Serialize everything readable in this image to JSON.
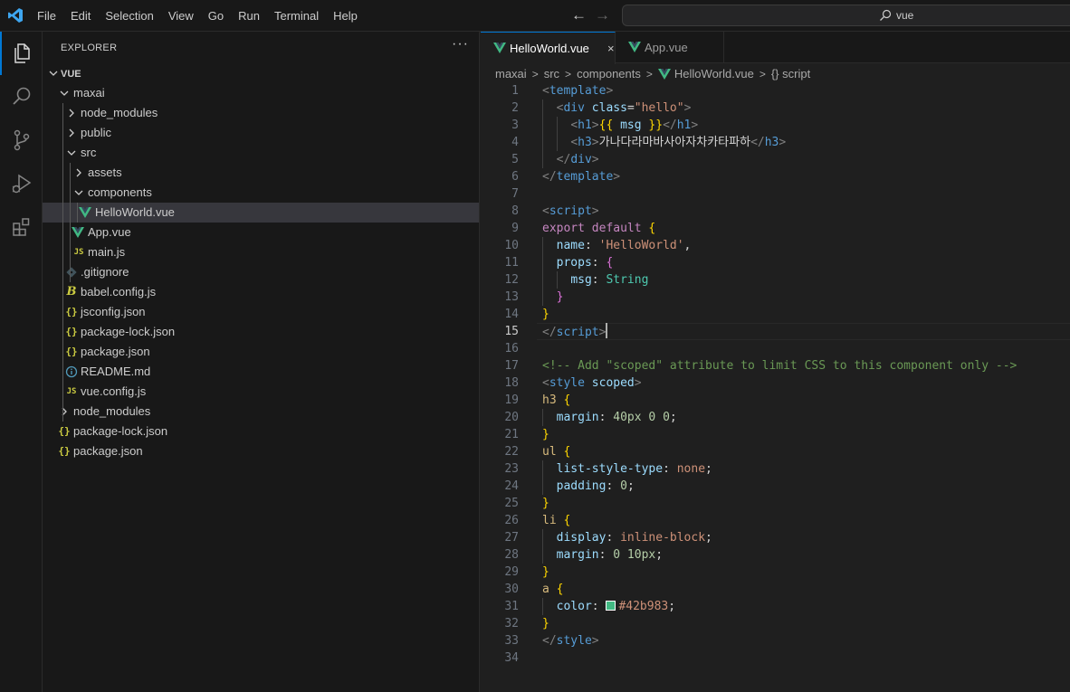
{
  "menu": [
    "File",
    "Edit",
    "Selection",
    "View",
    "Go",
    "Run",
    "Terminal",
    "Help"
  ],
  "nav": {
    "back": "←",
    "forward": "→"
  },
  "command_center": {
    "label": "vue"
  },
  "activity_bar": [
    "explorer-icon",
    "search-icon",
    "source-control-icon",
    "run-debug-icon",
    "extensions-icon"
  ],
  "explorer": {
    "title": "EXPLORER",
    "more": "···",
    "tree": [
      {
        "label": "VUE",
        "depth": 0,
        "type": "root",
        "icon": "chevron-down-icon"
      },
      {
        "label": "maxai",
        "depth": 1,
        "type": "folder-open",
        "icon": "chevron-down-icon"
      },
      {
        "label": "node_modules",
        "depth": 2,
        "type": "folder",
        "icon": "chevron-right-icon"
      },
      {
        "label": "public",
        "depth": 2,
        "type": "folder",
        "icon": "chevron-right-icon"
      },
      {
        "label": "src",
        "depth": 2,
        "type": "folder-open",
        "icon": "chevron-down-icon"
      },
      {
        "label": "assets",
        "depth": 3,
        "type": "folder",
        "icon": "chevron-right-icon"
      },
      {
        "label": "components",
        "depth": 3,
        "type": "folder-open",
        "icon": "chevron-down-icon"
      },
      {
        "label": "HelloWorld.vue",
        "depth": 4,
        "type": "vue",
        "icon": "vue-icon",
        "selected": true
      },
      {
        "label": "App.vue",
        "depth": 3,
        "type": "vue",
        "icon": "vue-icon"
      },
      {
        "label": "main.js",
        "depth": 3,
        "type": "js",
        "icon": "js-icon"
      },
      {
        "label": ".gitignore",
        "depth": 2,
        "type": "git",
        "icon": "git-icon"
      },
      {
        "label": "babel.config.js",
        "depth": 2,
        "type": "babel",
        "icon": "babel-icon"
      },
      {
        "label": "jsconfig.json",
        "depth": 2,
        "type": "json",
        "icon": "json-icon"
      },
      {
        "label": "package-lock.json",
        "depth": 2,
        "type": "json",
        "icon": "json-icon"
      },
      {
        "label": "package.json",
        "depth": 2,
        "type": "json",
        "icon": "json-icon"
      },
      {
        "label": "README.md",
        "depth": 2,
        "type": "info",
        "icon": "info-icon"
      },
      {
        "label": "vue.config.js",
        "depth": 2,
        "type": "js",
        "icon": "js-icon"
      },
      {
        "label": "node_modules",
        "depth": 1,
        "type": "folder",
        "icon": "chevron-right-icon"
      },
      {
        "label": "package-lock.json",
        "depth": 1,
        "type": "json",
        "icon": "json-icon"
      },
      {
        "label": "package.json",
        "depth": 1,
        "type": "json",
        "icon": "json-icon"
      }
    ]
  },
  "tabs": [
    {
      "label": "HelloWorld.vue",
      "active": true,
      "close": "×"
    },
    {
      "label": "App.vue",
      "active": false
    }
  ],
  "breadcrumb": [
    "maxai",
    "src",
    "components",
    "HelloWorld.vue",
    "{} script"
  ],
  "colors": {
    "accent": "#0078d4",
    "vue": "#41b883",
    "js": "#cbcb41",
    "swatch": "#42b983"
  },
  "cursor_line": 15,
  "code": [
    {
      "n": 1,
      "indent": 0,
      "tokens": [
        [
          "brk",
          "<"
        ],
        [
          "tag",
          "template"
        ],
        [
          "brk",
          ">"
        ]
      ]
    },
    {
      "n": 2,
      "indent": 1,
      "tokens": [
        [
          "brk",
          "<"
        ],
        [
          "tag",
          "div "
        ],
        [
          "attr",
          "class"
        ],
        [
          "txt",
          "="
        ],
        [
          "str",
          "\"hello\""
        ],
        [
          "brk",
          ">"
        ]
      ]
    },
    {
      "n": 3,
      "indent": 2,
      "tokens": [
        [
          "brk",
          "<"
        ],
        [
          "tag",
          "h1"
        ],
        [
          "brk",
          ">"
        ],
        [
          "yb",
          "{{"
        ],
        [
          "txt",
          " "
        ],
        [
          "attr",
          "msg"
        ],
        [
          "txt",
          " "
        ],
        [
          "yb",
          "}}"
        ],
        [
          "brk",
          "</"
        ],
        [
          "tag",
          "h1"
        ],
        [
          "brk",
          ">"
        ]
      ]
    },
    {
      "n": 4,
      "indent": 2,
      "tokens": [
        [
          "brk",
          "<"
        ],
        [
          "tag",
          "h3"
        ],
        [
          "brk",
          ">"
        ],
        [
          "txt",
          "가나다라마바사아자차카타파하"
        ],
        [
          "brk",
          "</"
        ],
        [
          "tag",
          "h3"
        ],
        [
          "brk",
          ">"
        ]
      ]
    },
    {
      "n": 5,
      "indent": 1,
      "tokens": [
        [
          "brk",
          "</"
        ],
        [
          "tag",
          "div"
        ],
        [
          "brk",
          ">"
        ]
      ]
    },
    {
      "n": 6,
      "indent": 0,
      "tokens": [
        [
          "brk",
          "</"
        ],
        [
          "tag",
          "template"
        ],
        [
          "brk",
          ">"
        ]
      ]
    },
    {
      "n": 7,
      "indent": 0,
      "tokens": []
    },
    {
      "n": 8,
      "indent": 0,
      "tokens": [
        [
          "brk",
          "<"
        ],
        [
          "tag",
          "script"
        ],
        [
          "brk",
          ">"
        ]
      ]
    },
    {
      "n": 9,
      "indent": 0,
      "tokens": [
        [
          "kw",
          "export default "
        ],
        [
          "yb",
          "{"
        ]
      ]
    },
    {
      "n": 10,
      "indent": 1,
      "tokens": [
        [
          "attr",
          "name"
        ],
        [
          "txt",
          ": "
        ],
        [
          "str",
          "'HelloWorld'"
        ],
        [
          "txt",
          ","
        ]
      ]
    },
    {
      "n": 11,
      "indent": 1,
      "tokens": [
        [
          "attr",
          "props"
        ],
        [
          "txt",
          ": "
        ],
        [
          "pb",
          "{"
        ]
      ]
    },
    {
      "n": 12,
      "indent": 2,
      "tokens": [
        [
          "attr",
          "msg"
        ],
        [
          "txt",
          ": "
        ],
        [
          "type",
          "String"
        ]
      ]
    },
    {
      "n": 13,
      "indent": 1,
      "tokens": [
        [
          "pb",
          "}"
        ]
      ]
    },
    {
      "n": 14,
      "indent": 0,
      "tokens": [
        [
          "yb",
          "}"
        ]
      ]
    },
    {
      "n": 15,
      "indent": 0,
      "tokens": [
        [
          "brk",
          "</"
        ],
        [
          "tag",
          "script"
        ],
        [
          "brk",
          ">"
        ]
      ]
    },
    {
      "n": 16,
      "indent": 0,
      "tokens": []
    },
    {
      "n": 17,
      "indent": 0,
      "tokens": [
        [
          "cmt",
          "<!-- Add \"scoped\" attribute to limit CSS to this component only -->"
        ]
      ]
    },
    {
      "n": 18,
      "indent": 0,
      "tokens": [
        [
          "brk",
          "<"
        ],
        [
          "tag",
          "style "
        ],
        [
          "attr",
          "scoped"
        ],
        [
          "brk",
          ">"
        ]
      ]
    },
    {
      "n": 19,
      "indent": 0,
      "tokens": [
        [
          "sel",
          "h3 "
        ],
        [
          "yb",
          "{"
        ]
      ]
    },
    {
      "n": 20,
      "indent": 1,
      "tokens": [
        [
          "attr",
          "margin"
        ],
        [
          "txt",
          ": "
        ],
        [
          "num",
          "40px 0 0"
        ],
        [
          "txt",
          ";"
        ]
      ]
    },
    {
      "n": 21,
      "indent": 0,
      "tokens": [
        [
          "yb",
          "}"
        ]
      ]
    },
    {
      "n": 22,
      "indent": 0,
      "tokens": [
        [
          "sel",
          "ul "
        ],
        [
          "yb",
          "{"
        ]
      ]
    },
    {
      "n": 23,
      "indent": 1,
      "tokens": [
        [
          "attr",
          "list-style-type"
        ],
        [
          "txt",
          ": "
        ],
        [
          "val",
          "none"
        ],
        [
          "txt",
          ";"
        ]
      ]
    },
    {
      "n": 24,
      "indent": 1,
      "tokens": [
        [
          "attr",
          "padding"
        ],
        [
          "txt",
          ": "
        ],
        [
          "num",
          "0"
        ],
        [
          "txt",
          ";"
        ]
      ]
    },
    {
      "n": 25,
      "indent": 0,
      "tokens": [
        [
          "yb",
          "}"
        ]
      ]
    },
    {
      "n": 26,
      "indent": 0,
      "tokens": [
        [
          "sel",
          "li "
        ],
        [
          "yb",
          "{"
        ]
      ]
    },
    {
      "n": 27,
      "indent": 1,
      "tokens": [
        [
          "attr",
          "display"
        ],
        [
          "txt",
          ": "
        ],
        [
          "val",
          "inline-block"
        ],
        [
          "txt",
          ";"
        ]
      ]
    },
    {
      "n": 28,
      "indent": 1,
      "tokens": [
        [
          "attr",
          "margin"
        ],
        [
          "txt",
          ": "
        ],
        [
          "num",
          "0 10px"
        ],
        [
          "txt",
          ";"
        ]
      ]
    },
    {
      "n": 29,
      "indent": 0,
      "tokens": [
        [
          "yb",
          "}"
        ]
      ]
    },
    {
      "n": 30,
      "indent": 0,
      "tokens": [
        [
          "sel",
          "a "
        ],
        [
          "yb",
          "{"
        ]
      ]
    },
    {
      "n": 31,
      "indent": 1,
      "tokens": [
        [
          "attr",
          "color"
        ],
        [
          "txt",
          ": "
        ],
        [
          "swatch",
          ""
        ],
        [
          "val",
          "#42b983"
        ],
        [
          "txt",
          ";"
        ]
      ]
    },
    {
      "n": 32,
      "indent": 0,
      "tokens": [
        [
          "yb",
          "}"
        ]
      ]
    },
    {
      "n": 33,
      "indent": 0,
      "tokens": [
        [
          "brk",
          "</"
        ],
        [
          "tag",
          "style"
        ],
        [
          "brk",
          ">"
        ]
      ]
    },
    {
      "n": 34,
      "indent": 0,
      "tokens": []
    }
  ]
}
